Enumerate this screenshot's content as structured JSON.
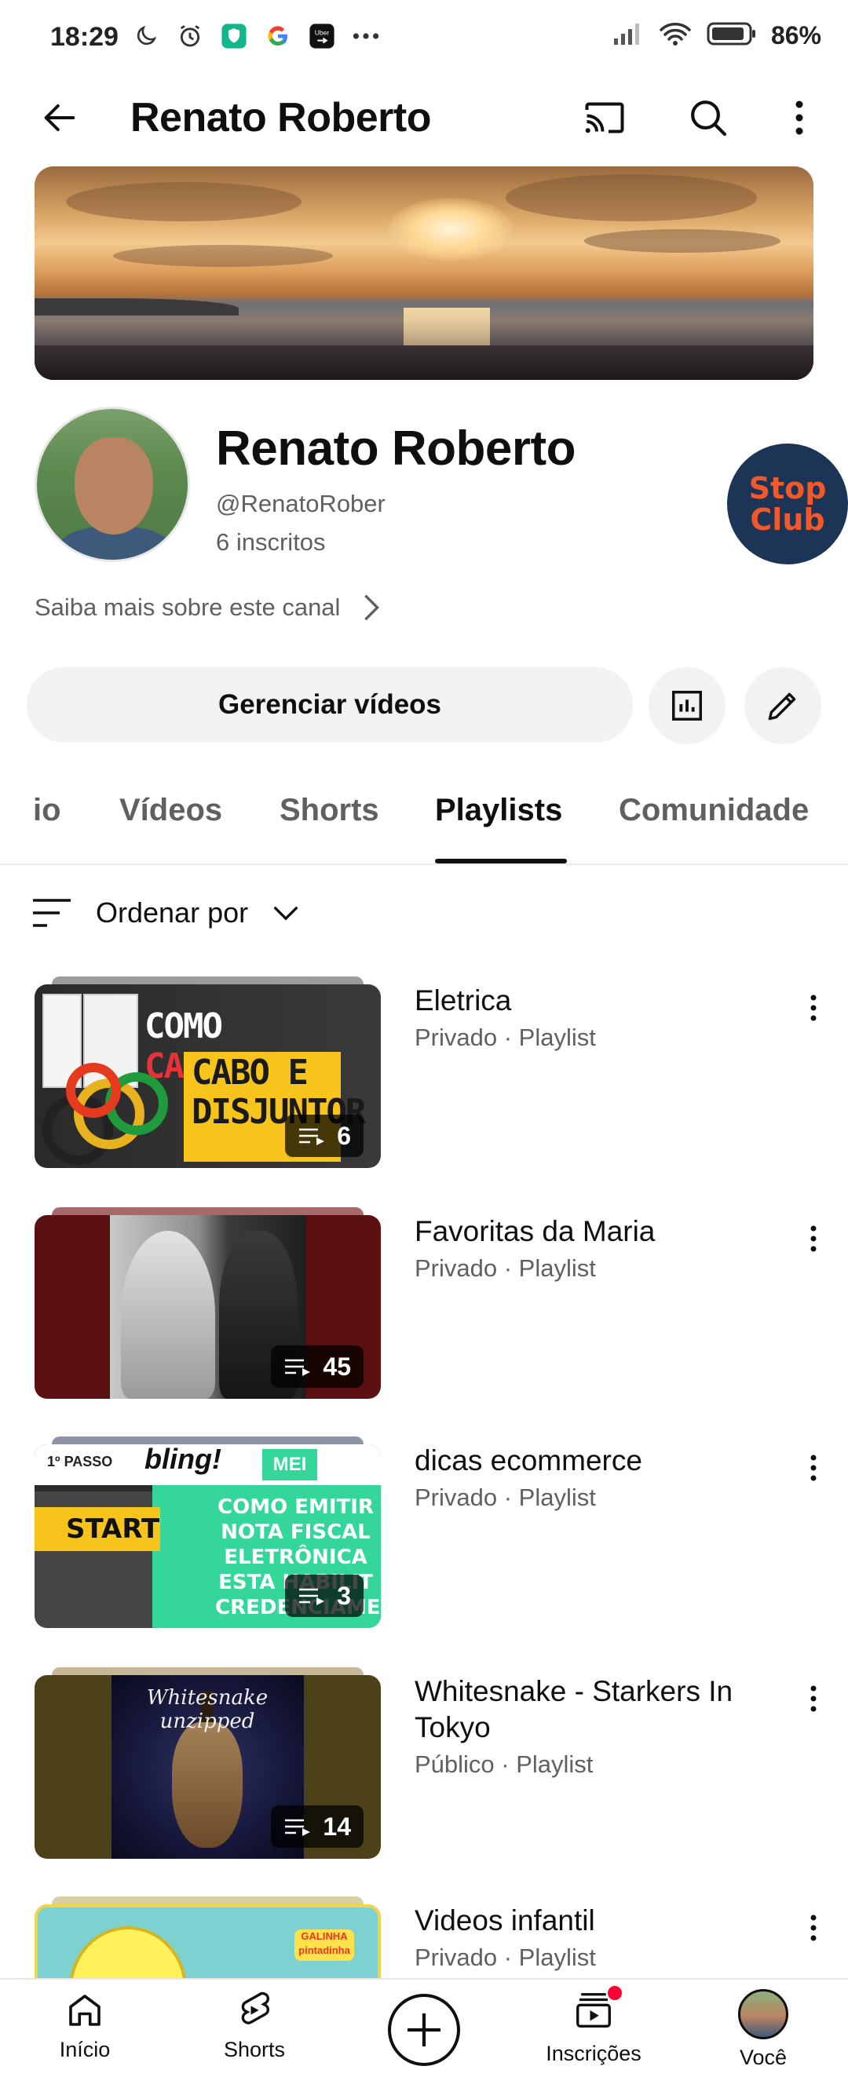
{
  "status_bar": {
    "time": "18:29",
    "battery": "86%",
    "icons": [
      "moon-icon",
      "alarm-icon",
      "shield-app-icon",
      "google-icon",
      "uber-icon",
      "more-notifications-icon",
      "signal-icon",
      "wifi-icon",
      "battery-icon"
    ]
  },
  "app_bar": {
    "title": "Renato Roberto"
  },
  "channel": {
    "name": "Renato Roberto",
    "handle": "@RenatoRober",
    "subscribers": "6 inscritos",
    "about_link": "Saiba mais sobre este canal",
    "badge_line1": "Stop",
    "badge_line2": "Club"
  },
  "actions": {
    "manage_videos": "Gerenciar vídeos"
  },
  "tabs": [
    {
      "label": "io",
      "active": false
    },
    {
      "label": "Vídeos",
      "active": false
    },
    {
      "label": "Shorts",
      "active": false
    },
    {
      "label": "Playlists",
      "active": true
    },
    {
      "label": "Comunidade",
      "active": false
    }
  ],
  "sort": {
    "label": "Ordenar por"
  },
  "playlists": [
    {
      "title": "Eletrica",
      "meta": "Privado · Playlist",
      "count": "6",
      "thumb_text_1": "COMO",
      "thumb_text_2": "CALCULAR",
      "thumb_text_3": "CABO E",
      "thumb_text_4": "DISJUNTOR"
    },
    {
      "title": "Favoritas da Maria",
      "meta": "Privado · Playlist",
      "count": "45"
    },
    {
      "title": "dicas ecommerce",
      "meta": "Privado · Playlist",
      "count": "3",
      "thumb_step": "1º PASSO",
      "thumb_brand": "bling!",
      "thumb_mei": "MEI",
      "thumb_start": "START",
      "thumb_text": "COMO EMITIR NOTA FISCAL ELETRÔNICA ESTA HABILIT CREDENCIAMENTO"
    },
    {
      "title": "Whitesnake - Starkers In Tokyo",
      "meta": "Público · Playlist",
      "count": "14",
      "thumb_logo": "Whitesnake",
      "thumb_sub": "unzipped"
    },
    {
      "title": "Videos infantil",
      "meta": "Privado · Playlist",
      "thumb_badge": "GALINHA pintadinha"
    }
  ],
  "bottom_nav": {
    "home": "Início",
    "shorts": "Shorts",
    "subscriptions": "Inscrições",
    "you": "Você"
  },
  "colors": {
    "accent_red": "#ff0033",
    "text_primary": "#0f0f0f",
    "text_secondary": "#606060",
    "chip_bg": "#f2f2f2"
  }
}
